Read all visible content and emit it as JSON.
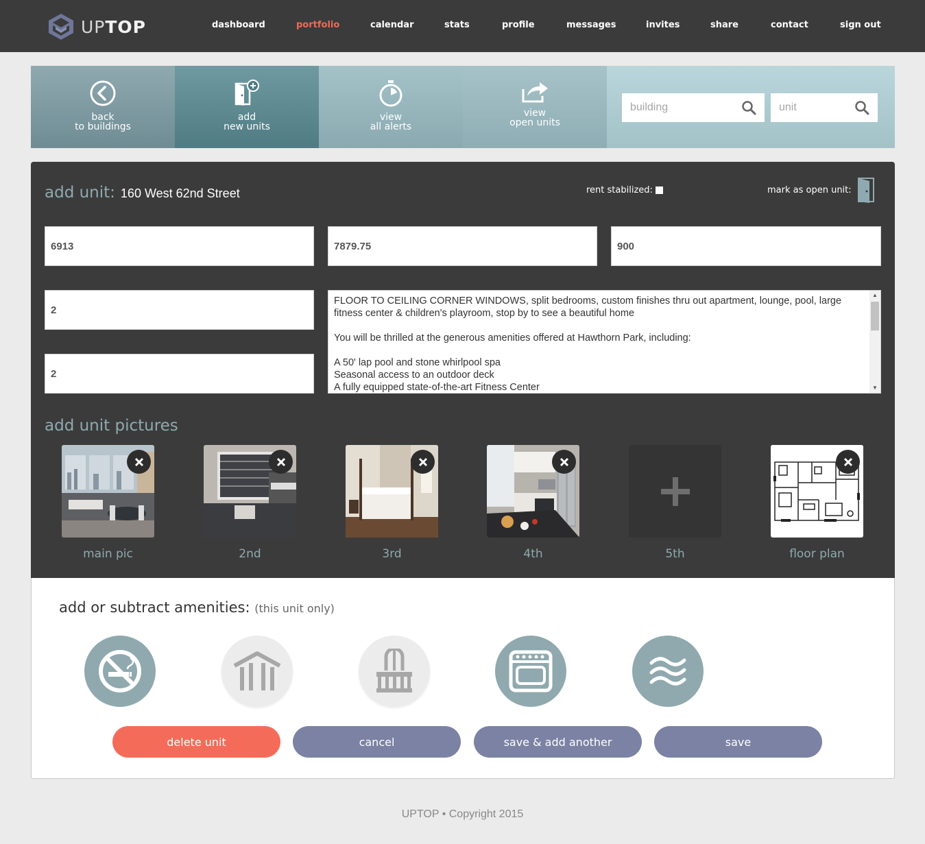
{
  "app": {
    "logo_text_light": "UP",
    "logo_text_bold": "TOP"
  },
  "nav": {
    "items": [
      "dashboard",
      "portfolio",
      "calendar",
      "stats",
      "profile",
      "messages",
      "invites",
      "share",
      "contact",
      "sign out"
    ],
    "active": "portfolio"
  },
  "actions": {
    "back": {
      "line1": "back",
      "line2": "to buildings",
      "icon": "back-arrow-circle-icon"
    },
    "add": {
      "line1": "add",
      "line2": "new units",
      "icon": "door-plus-icon"
    },
    "alerts": {
      "line1": "view",
      "line2": "all alerts",
      "icon": "stopwatch-icon"
    },
    "open": {
      "line1": "view",
      "line2": "open units",
      "icon": "share-arrow-icon"
    }
  },
  "search": {
    "building_placeholder": "building",
    "unit_placeholder": "unit"
  },
  "form": {
    "title_label": "add unit:",
    "address": "160 West 62nd Street",
    "rent_stabilized_label": "rent stabilized:",
    "rent_stabilized_checked": false,
    "open_unit_label": "mark as open unit:",
    "field1": "6913",
    "field2": "7879.75",
    "field3": "900",
    "field4": "2",
    "field5": "2",
    "description": "FLOOR TO CEILING CORNER WINDOWS, split bedrooms, custom finishes thru out apartment, lounge, pool, large fitness center & children's playroom, stop by to see a beautiful home\n\nYou will be thrilled at the generous amenities offered at Hawthorn Park, including:\n\nA 50' lap pool and stone whirlpool spa\nSeasonal access to an outdoor deck\nA fully equipped state-of-the-art Fitness Center"
  },
  "pictures": {
    "title": "add unit pictures",
    "items": [
      {
        "label": "main pic",
        "has_image": true
      },
      {
        "label": "2nd",
        "has_image": true
      },
      {
        "label": "3rd",
        "has_image": true
      },
      {
        "label": "4th",
        "has_image": true
      },
      {
        "label": "5th",
        "has_image": false
      },
      {
        "label": "floor plan",
        "has_image": true
      }
    ]
  },
  "amenities": {
    "title": "add or subtract amenities:",
    "subtitle": "(this unit only)",
    "items": [
      {
        "icon": "no-smoking-icon",
        "active": true
      },
      {
        "icon": "gazebo-icon",
        "active": false
      },
      {
        "icon": "balcony-icon",
        "active": false
      },
      {
        "icon": "oven-icon",
        "active": true
      },
      {
        "icon": "waves-icon",
        "active": true
      }
    ]
  },
  "buttons": {
    "delete": "delete unit",
    "cancel": "cancel",
    "save_add": "save & add another",
    "save": "save"
  },
  "colors": {
    "accent_red": "#f46c59",
    "teal": "#8eaab0",
    "button_gray": "#7b82a3",
    "dark": "#3b3b3b"
  },
  "footer": "UPTOP • Copyright 2015"
}
